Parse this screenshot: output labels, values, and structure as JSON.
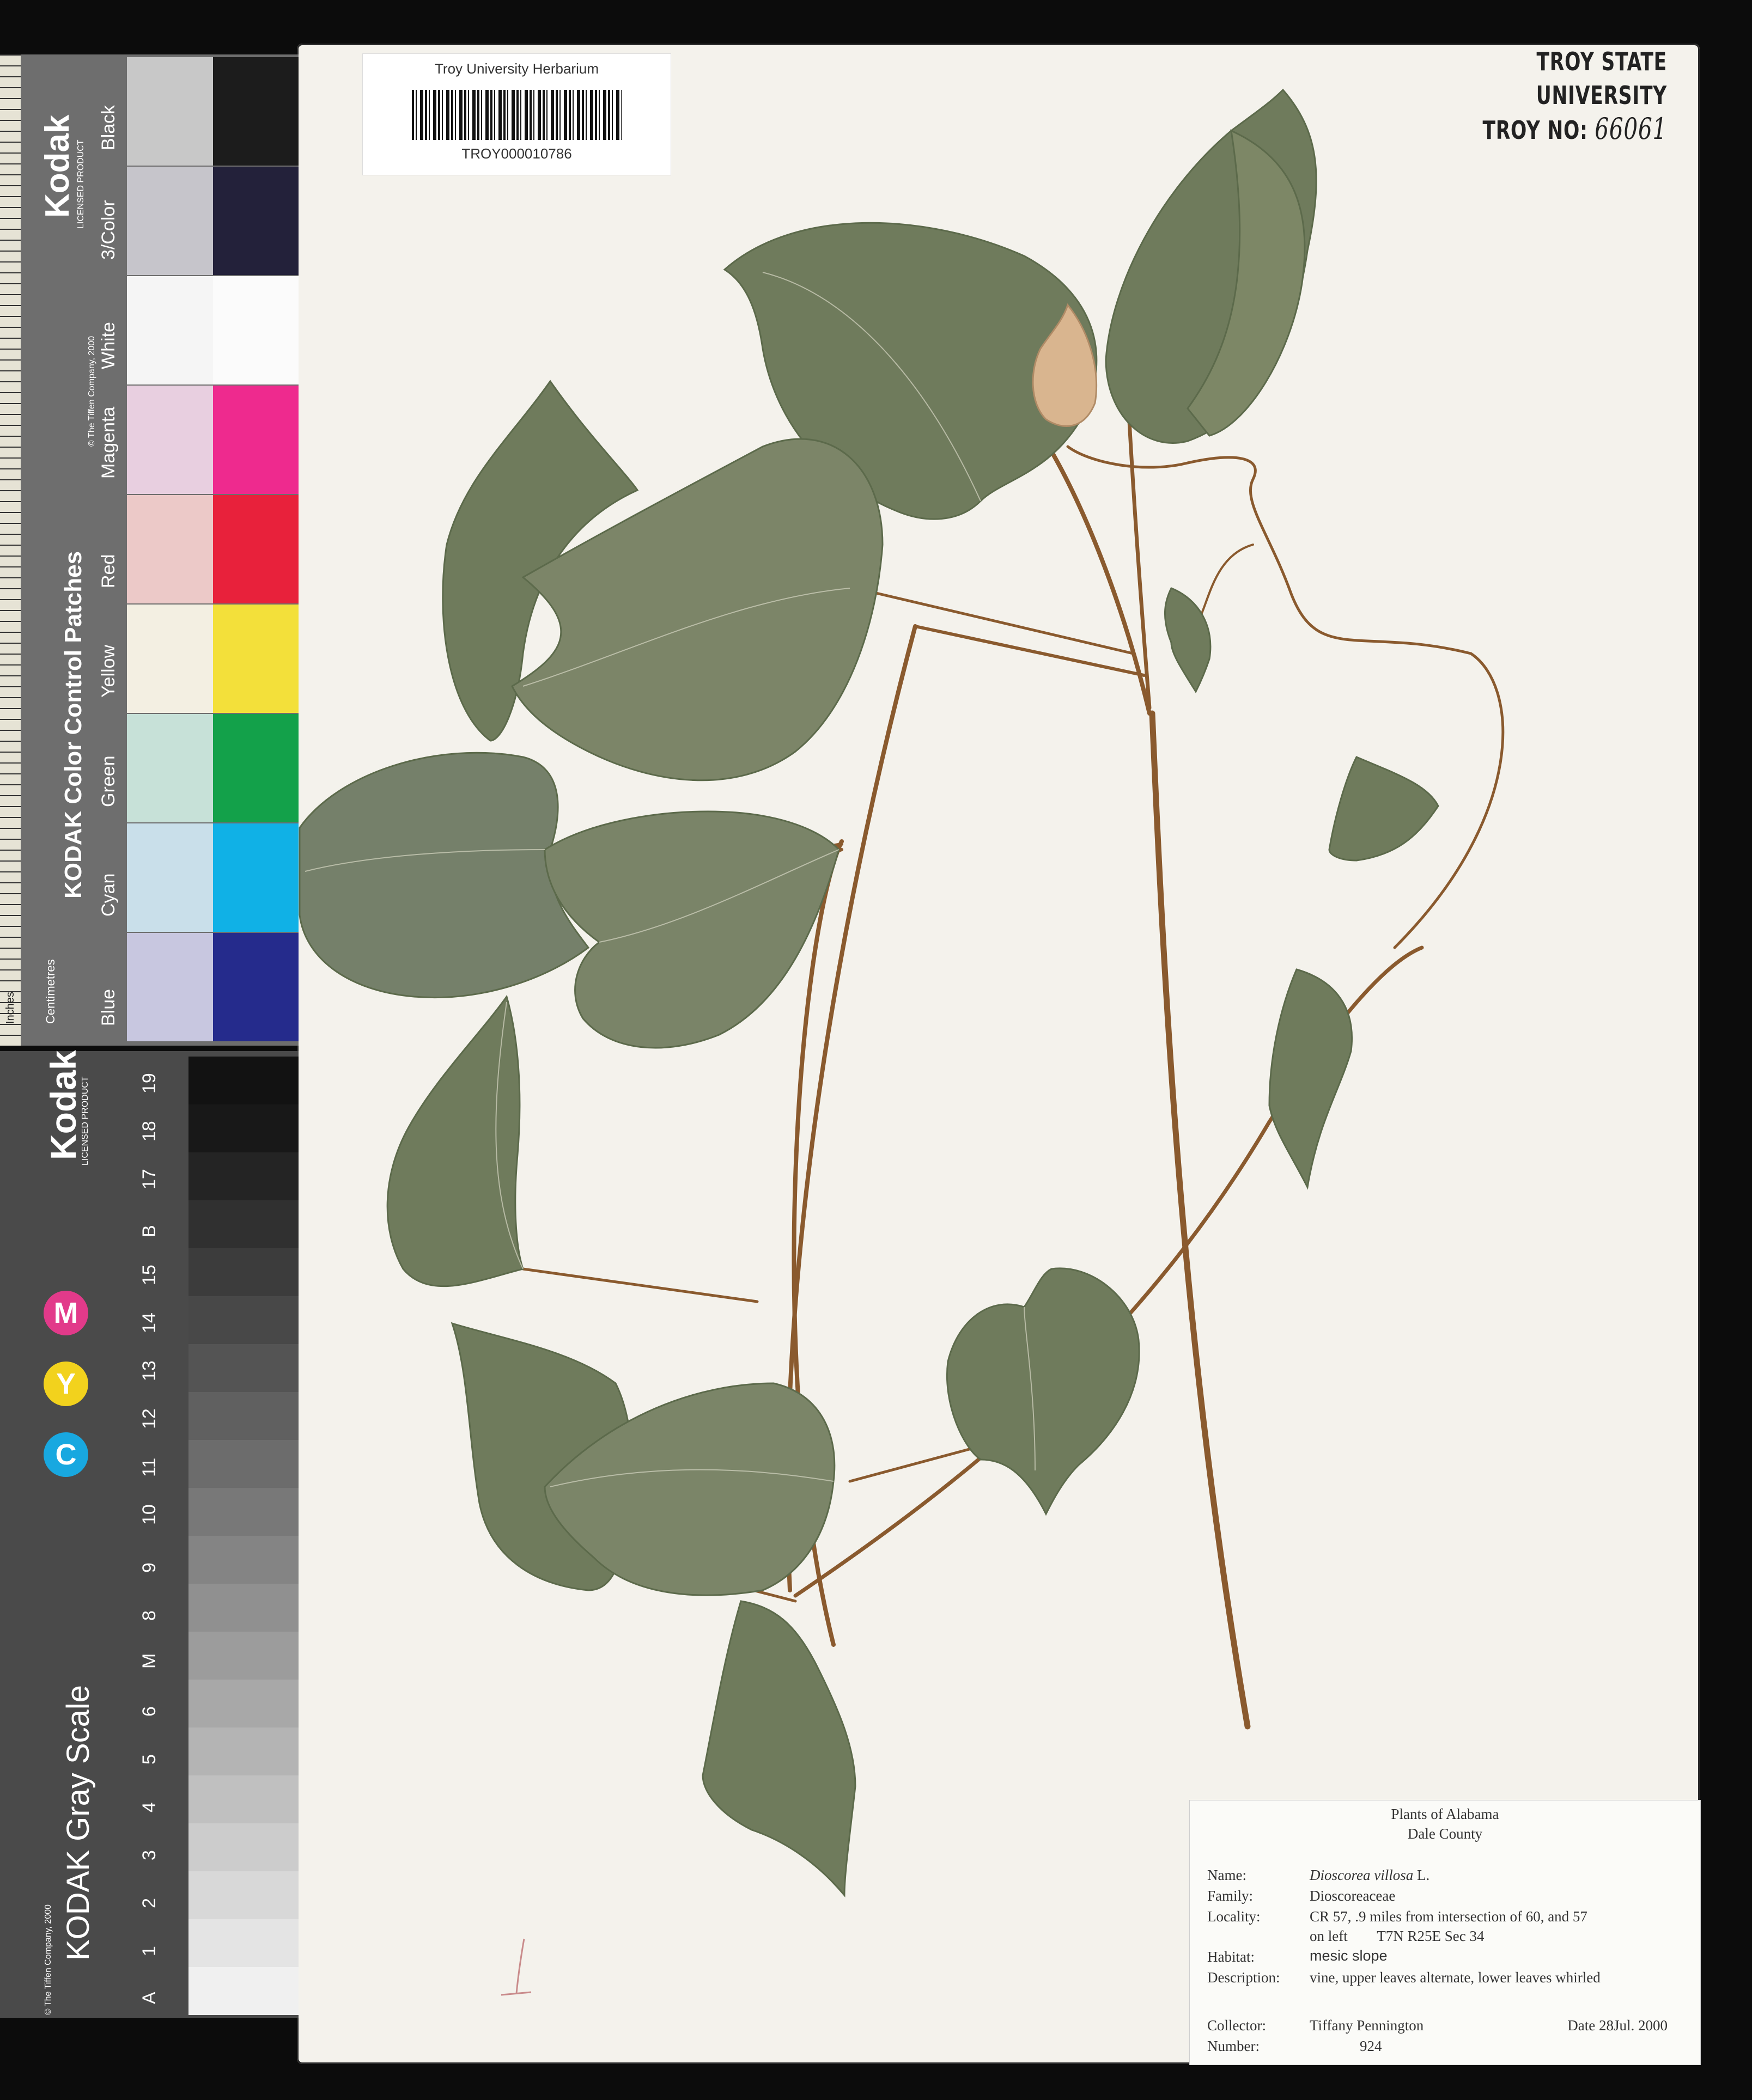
{
  "barcode_label": {
    "herbarium": "Troy University Herbarium",
    "catalog_number": "TROY000010786"
  },
  "stamp": {
    "institution": "TROY STATE UNIVERSITY",
    "number_prefix": "TROY NO:",
    "number_value": "66061"
  },
  "label": {
    "title": "Plants of Alabama",
    "county": "Dale County",
    "fields": {
      "name_key": "Name:",
      "name_value": "Dioscorea villosa",
      "name_author": "L.",
      "family_key": "Family:",
      "family_value": "Dioscoreaceae",
      "locality_key": "Locality:",
      "locality_value_1": "CR 57, .9 miles from intersection of 60, and 57",
      "locality_value_2": "on left        T7N R25E Sec 34",
      "habitat_key": "Habitat:",
      "habitat_value": "mesic slope",
      "description_key": "Description:",
      "description_value": "vine, upper leaves alternate, lower leaves whirled",
      "collector_key": "Collector:",
      "collector_value": "Tiffany Pennington",
      "date_value": "Date 28Jul. 2000",
      "number_key": "Number:",
      "number_value": "924"
    }
  },
  "color_card": {
    "brand": "Kodak",
    "licensed": "LICENSED PRODUCT",
    "title": "KODAK Color Control Patches",
    "copyright": "© The Tiffen Company, 2000",
    "ruler_units": [
      "Centimetres",
      "Inches"
    ],
    "patches": [
      {
        "name": "Black",
        "light": "#c8c8c8",
        "dark": "#1c1c1c"
      },
      {
        "name": "3/Color",
        "light": "#c6c5cb",
        "dark": "#23213a"
      },
      {
        "name": "White",
        "light": "#f5f5f5",
        "dark": "#fbfbfb"
      },
      {
        "name": "Magenta",
        "light": "#e8cfe0",
        "dark": "#ee2a8e"
      },
      {
        "name": "Red",
        "light": "#ecc9c8",
        "dark": "#e8213b"
      },
      {
        "name": "Yellow",
        "light": "#f3efe2",
        "dark": "#f3e03a"
      },
      {
        "name": "Green",
        "light": "#c7e1d8",
        "dark": "#13a14a"
      },
      {
        "name": "Cyan",
        "light": "#c9dfea",
        "dark": "#10b1e6"
      },
      {
        "name": "Blue",
        "light": "#c8c7e0",
        "dark": "#252b8c"
      }
    ]
  },
  "gray_card": {
    "brand": "Kodak",
    "licensed": "LICENSED PRODUCT",
    "title": "KODAK Gray Scale",
    "copyright": "© The Tiffen Company, 2000",
    "cym": [
      "C",
      "Y",
      "M"
    ],
    "cym_colors": [
      "#18a8e0",
      "#f2d21d",
      "#e23a8a"
    ],
    "steps": [
      "A",
      "1",
      "2",
      "3",
      "4",
      "5",
      "6",
      "M",
      "8",
      "9",
      "10",
      "11",
      "12",
      "13",
      "14",
      "15",
      "B",
      "17",
      "18",
      "19"
    ]
  }
}
